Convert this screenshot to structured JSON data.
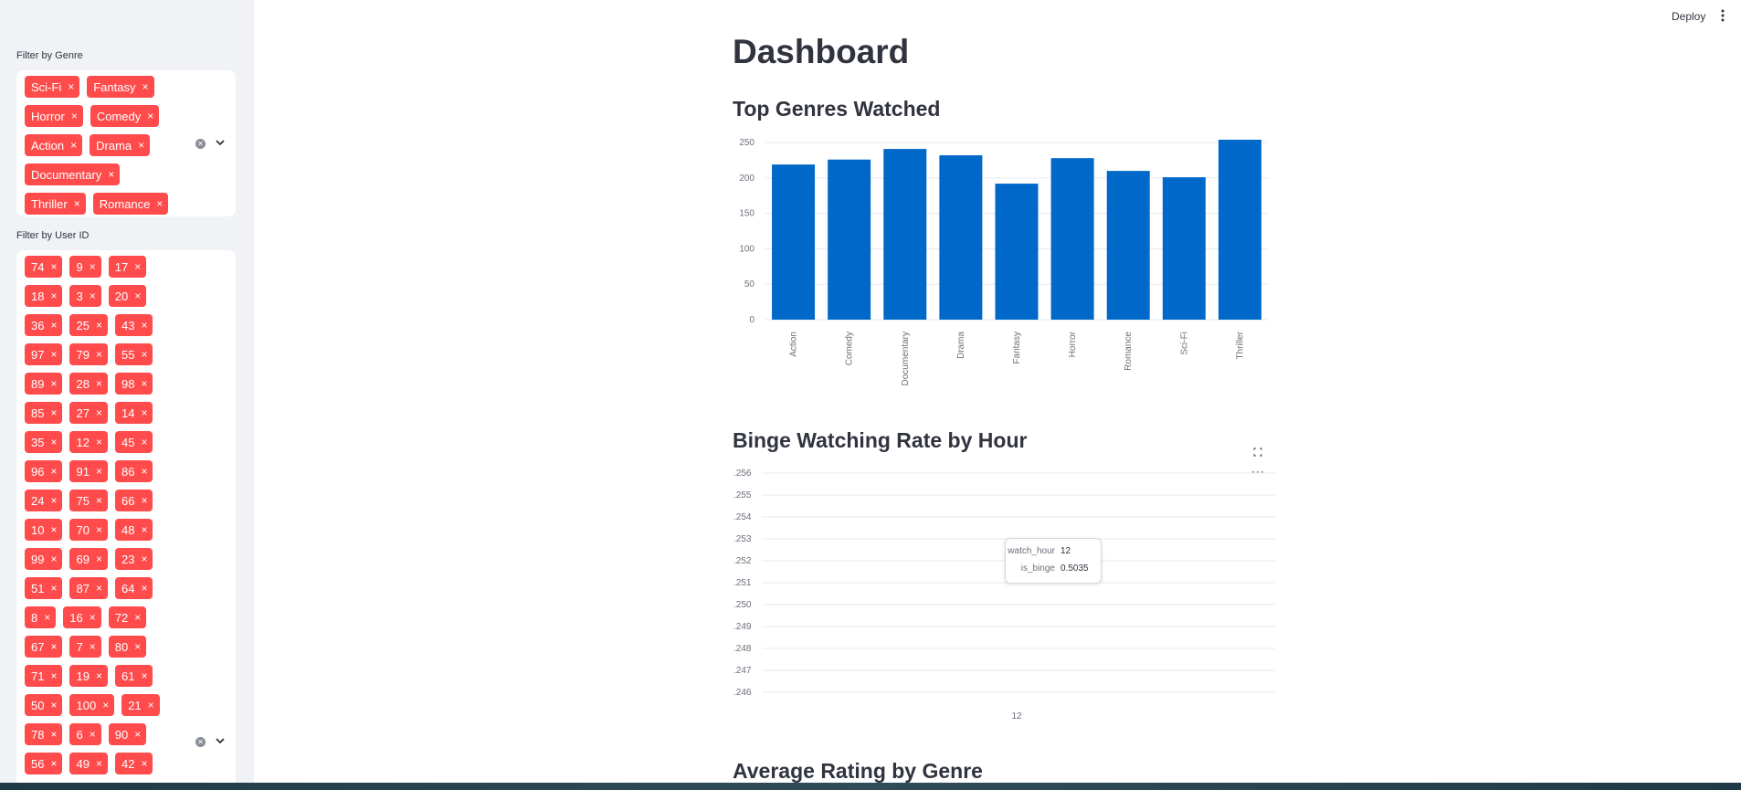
{
  "sidebar": {
    "genre_filter": {
      "label": "Filter by Genre",
      "chips": [
        [
          "Sci-Fi",
          "Fantasy"
        ],
        [
          "Horror",
          "Comedy"
        ],
        [
          "Action",
          "Drama"
        ],
        [
          "Documentary"
        ],
        [
          "Thriller",
          "Romance"
        ]
      ]
    },
    "user_filter": {
      "label": "Filter by User ID",
      "chips": [
        [
          "74",
          "9",
          "17"
        ],
        [
          "18",
          "3",
          "20"
        ],
        [
          "36",
          "25",
          "43"
        ],
        [
          "97",
          "79",
          "55"
        ],
        [
          "89",
          "28",
          "98"
        ],
        [
          "85",
          "27",
          "14"
        ],
        [
          "35",
          "12",
          "45"
        ],
        [
          "96",
          "91",
          "86"
        ],
        [
          "24",
          "75",
          "66"
        ],
        [
          "10",
          "70",
          "48"
        ],
        [
          "99",
          "69",
          "23"
        ],
        [
          "51",
          "87",
          "64"
        ],
        [
          "8",
          "16",
          "72"
        ],
        [
          "67",
          "7",
          "80"
        ],
        [
          "71",
          "19",
          "61"
        ],
        [
          "50",
          "100",
          "21"
        ],
        [
          "78",
          "6",
          "90"
        ],
        [
          "56",
          "49",
          "42"
        ]
      ]
    },
    "chip_remove_symbol": "×",
    "chip_color": "#ff4b4b"
  },
  "header": {
    "deploy_label": "Deploy",
    "menu_icon": "kebab-menu-icon"
  },
  "main": {
    "title": "Dashboard",
    "sections": [
      {
        "title": "Top Genres Watched"
      },
      {
        "title": "Binge Watching Rate by Hour"
      },
      {
        "title": "Average Rating by Genre"
      }
    ],
    "tooltip": {
      "key1": "watch_hour",
      "val1": "12",
      "key2": "is_binge",
      "val2": "0.5035"
    }
  },
  "chart_data": [
    {
      "type": "bar",
      "categories": [
        "Action",
        "Comedy",
        "Documentary",
        "Drama",
        "Fantasy",
        "Horror",
        "Romance",
        "Sci-Fi",
        "Thriller"
      ],
      "values": [
        219,
        226,
        241,
        232,
        192,
        228,
        210,
        201,
        254
      ],
      "yticks": [
        0,
        50,
        100,
        150,
        200,
        250
      ],
      "ylim": [
        0,
        254
      ],
      "bar_color": "#0068c9",
      "grid": true
    },
    {
      "type": "line",
      "x": [
        12
      ],
      "xticks": [
        "12"
      ],
      "yticks": [
        ".256",
        ".255",
        ".254",
        ".253",
        ".252",
        ".251",
        ".250",
        ".249",
        ".248",
        ".247",
        ".246"
      ],
      "grid": true
    }
  ]
}
